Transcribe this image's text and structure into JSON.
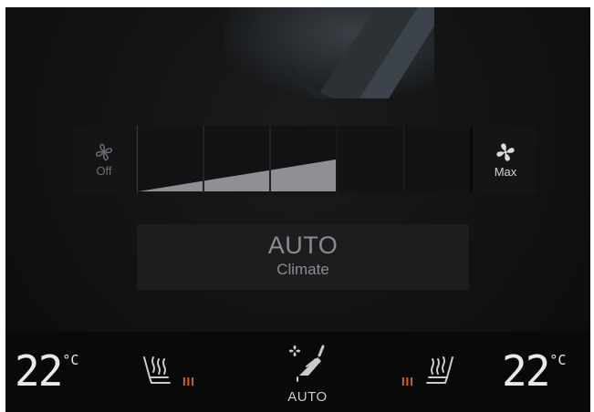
{
  "fan": {
    "off_label": "Off",
    "max_label": "Max",
    "level": 3,
    "max_level": 5
  },
  "climate": {
    "auto_title": "AUTO",
    "auto_subtitle": "Climate"
  },
  "bottom_bar": {
    "driver_temp": "22",
    "passenger_temp": "22",
    "temp_unit": "°C",
    "seat_heat_indicator": "III",
    "air_dist_label": "AUTO"
  },
  "colors": {
    "heat_accent": "#d9661c",
    "fan_fill": "#8e9093"
  },
  "icons": {
    "fan_off": "fan-outline-icon",
    "fan_max": "fan-filled-icon",
    "seat_heat": "seat-heating-icon",
    "air_distribution": "air-distribution-icon"
  }
}
